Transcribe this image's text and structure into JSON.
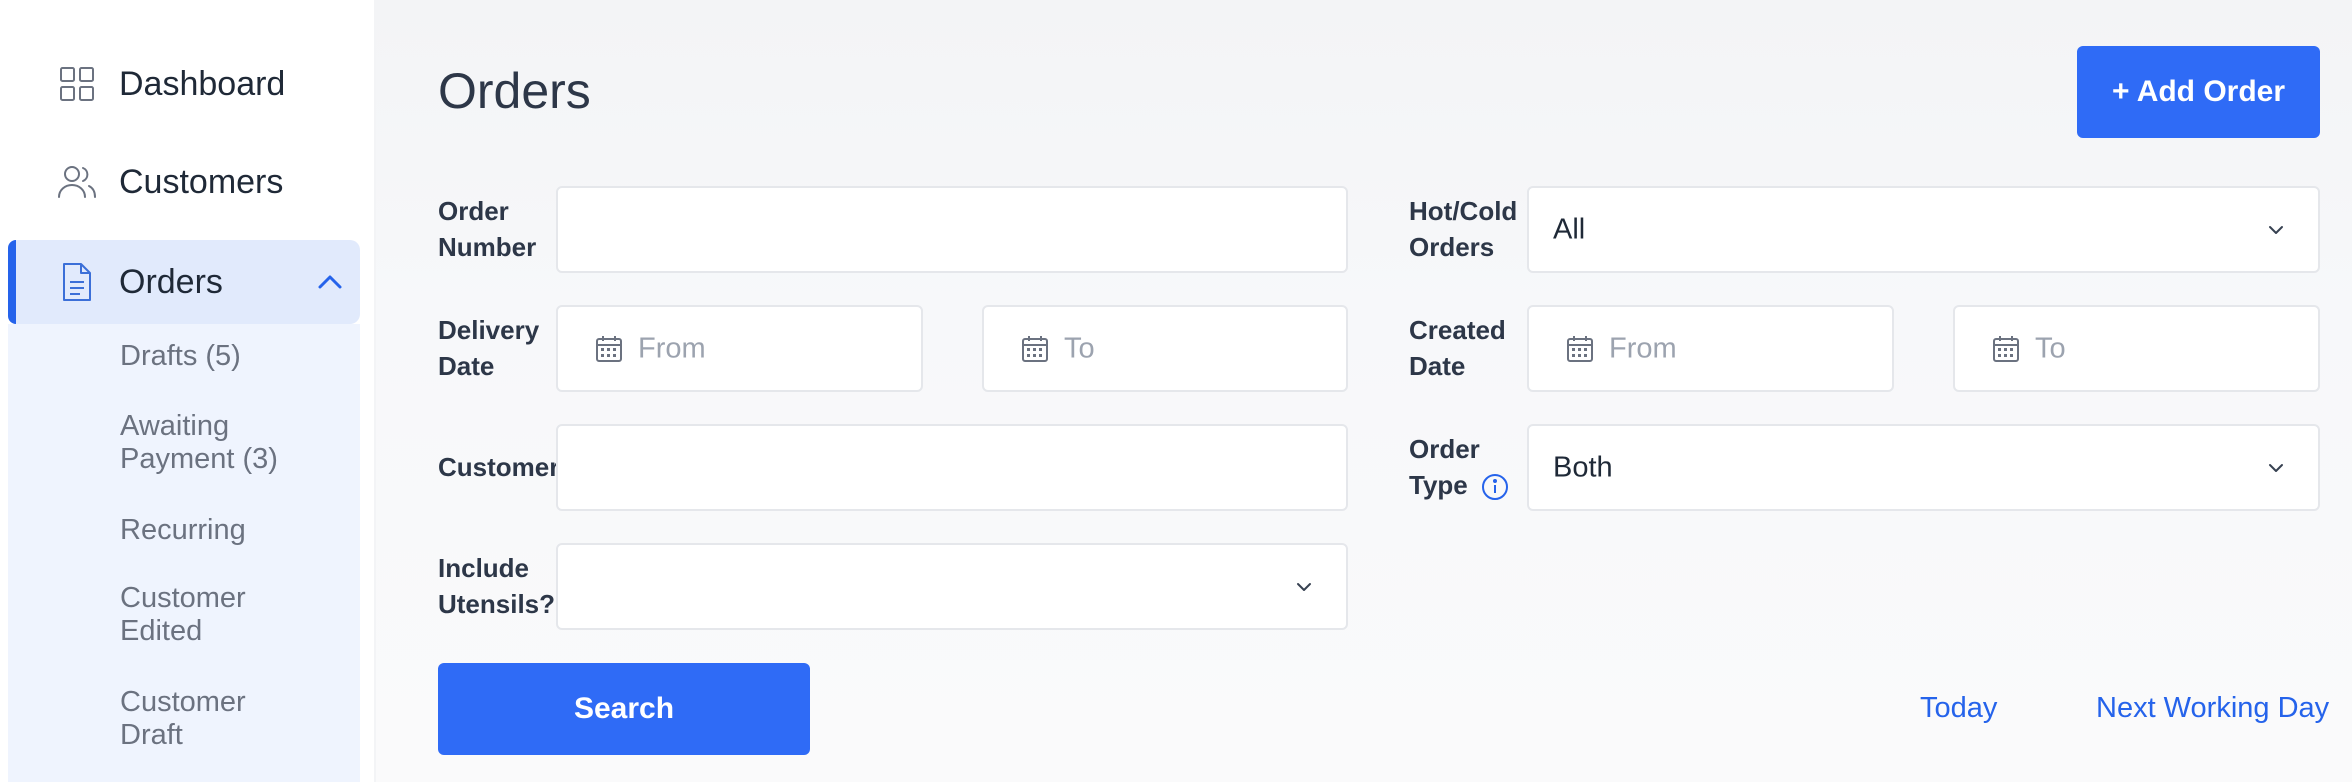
{
  "sidebar": {
    "items": [
      {
        "label": "Dashboard",
        "icon": "grid-icon"
      },
      {
        "label": "Customers",
        "icon": "users-icon"
      },
      {
        "label": "Orders",
        "icon": "document-icon",
        "expanded": true,
        "active": true
      }
    ],
    "submenu": [
      {
        "label": "Drafts (5)"
      },
      {
        "label": "Awaiting Payment (3)"
      },
      {
        "label": "Recurring"
      },
      {
        "label": "Customer Edited"
      },
      {
        "label": "Customer Draft"
      }
    ]
  },
  "header": {
    "title": "Orders",
    "add_button_label": "+ Add Order"
  },
  "filters": {
    "order_number": {
      "label": "Order Number",
      "value": ""
    },
    "hot_cold": {
      "label": "Hot/Cold Orders",
      "value": "All"
    },
    "delivery_date": {
      "label": "Delivery Date",
      "from_placeholder": "From",
      "to_placeholder": "To"
    },
    "created_date": {
      "label": "Created Date",
      "from_placeholder": "From",
      "to_placeholder": "To"
    },
    "customer": {
      "label": "Customer",
      "value": ""
    },
    "order_type": {
      "label": "Order Type",
      "value": "Both"
    },
    "utensils": {
      "label": "Include Utensils?",
      "value": ""
    }
  },
  "actions": {
    "search_label": "Search",
    "today_label": "Today",
    "next_working_day_label": "Next Working Day"
  },
  "colors": {
    "accent": "#2f6bf6",
    "active_nav_bg": "#e1eafc",
    "submenu_bg": "#eff4fe",
    "link": "#2563eb"
  }
}
